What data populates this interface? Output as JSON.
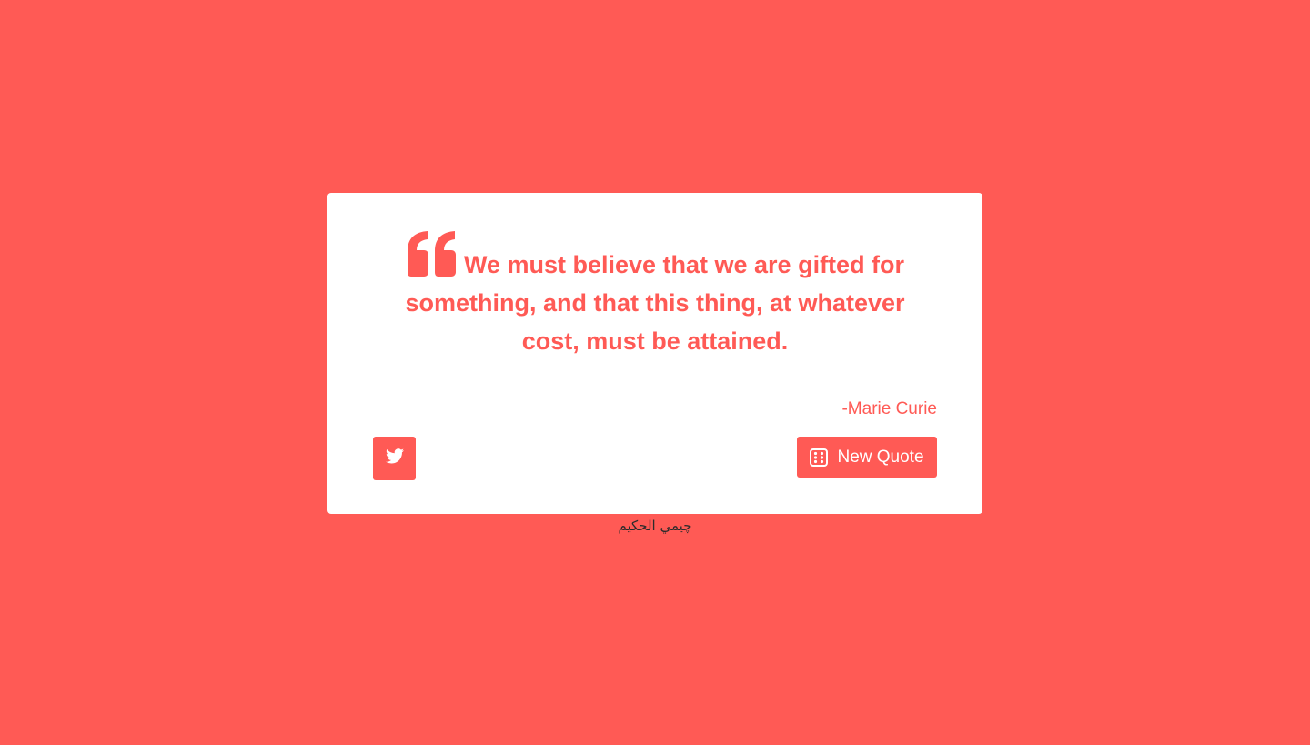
{
  "colors": {
    "background": "#ff5a55",
    "card": "#ffffff",
    "accent": "#ff5a55",
    "footer_text": "#2b2b2b"
  },
  "quote": {
    "icon": "quote-left-icon",
    "text": "We must believe that we are gifted for something, and that this thing, at whatever cost, must be attained.",
    "author": "-Marie Curie"
  },
  "actions": {
    "twitter_icon": "twitter-icon",
    "new_quote_icon": "dice-icon",
    "new_quote_label": "New Quote"
  },
  "footer": {
    "credit": "چيمي الحكيم"
  }
}
